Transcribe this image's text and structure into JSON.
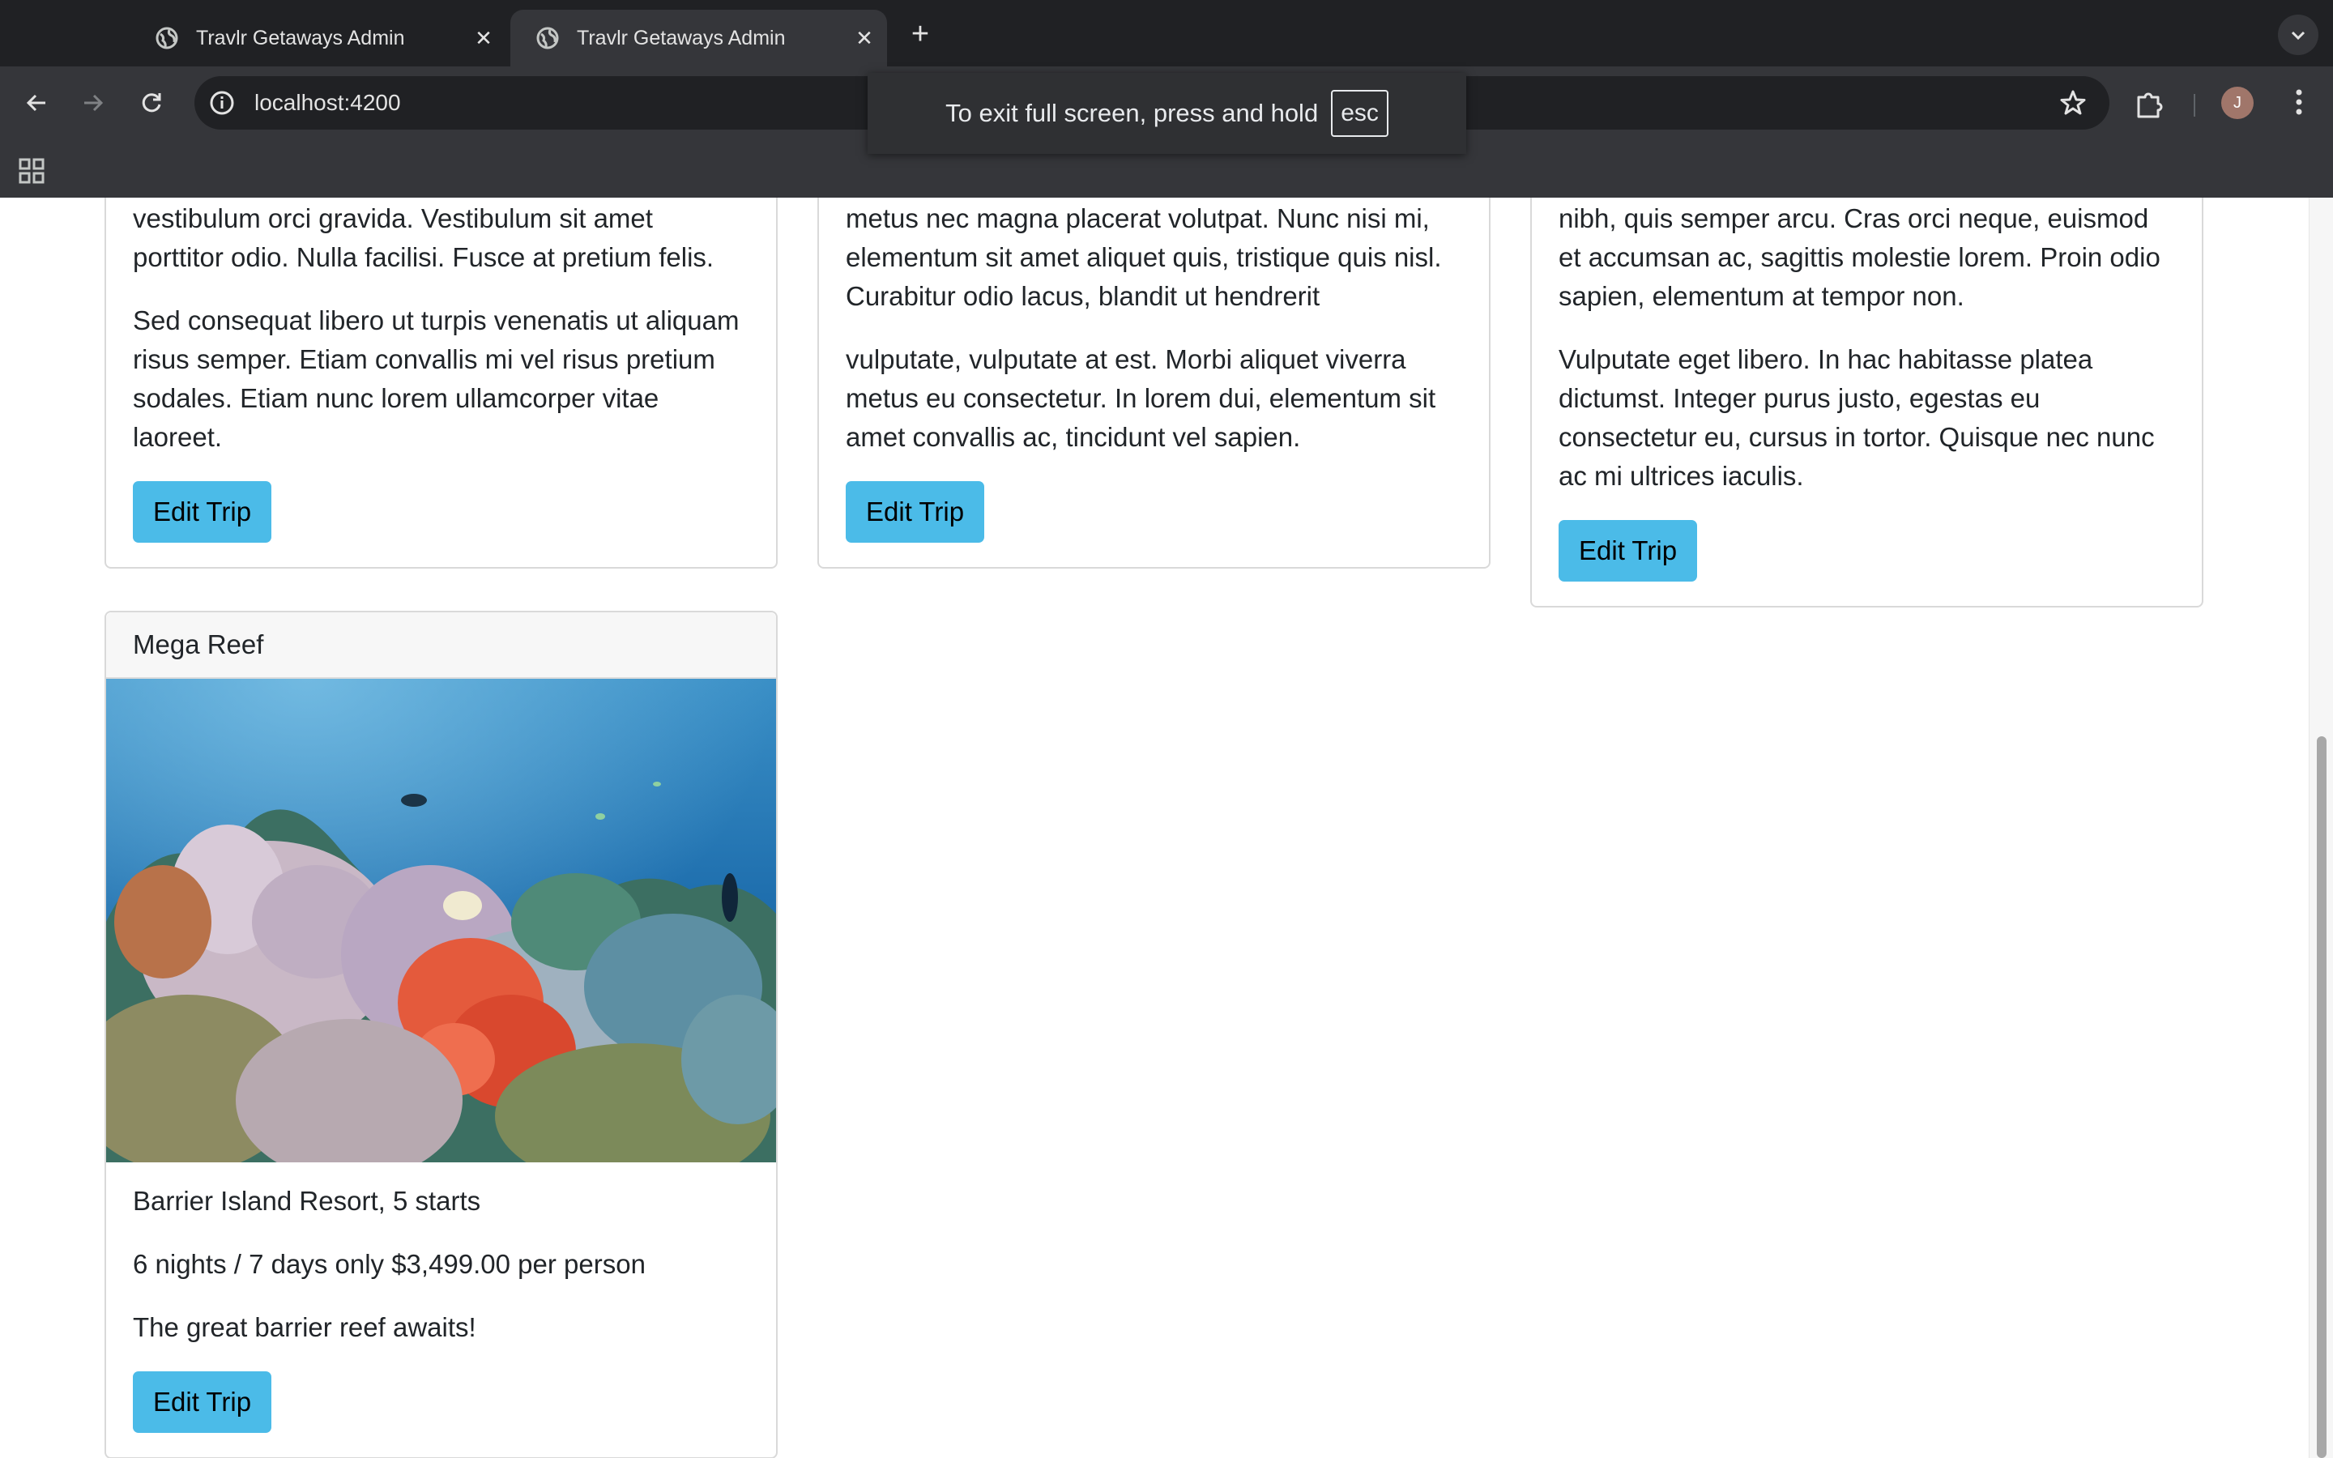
{
  "browser": {
    "tabs": [
      {
        "title": "Travlr Getaways Admin",
        "active": false
      },
      {
        "title": "Travlr Getaways Admin",
        "active": true
      }
    ],
    "url": "localhost:4200",
    "profile_initial": "J",
    "fullscreen_notice": {
      "text": "To exit full screen, press and hold",
      "key": "esc"
    }
  },
  "cards": [
    {
      "paragraphs": [
        "vestibulum orci gravida. Vestibulum sit amet porttitor odio. Nulla facilisi. Fusce at pretium felis.",
        "Sed consequat libero ut turpis venenatis ut aliquam risus semper. Etiam convallis mi vel risus pretium sodales. Etiam nunc lorem ullamcorper vitae laoreet."
      ],
      "button": "Edit Trip"
    },
    {
      "paragraphs": [
        "metus nec magna placerat volutpat. Nunc nisi mi, elementum sit amet aliquet quis, tristique quis nisl. Curabitur odio lacus, blandit ut hendrerit",
        "vulputate, vulputate at est. Morbi aliquet viverra metus eu consectetur. In lorem dui, elementum sit amet convallis ac, tincidunt vel sapien."
      ],
      "button": "Edit Trip"
    },
    {
      "paragraphs": [
        "nibh, quis semper arcu. Cras orci neque, euismod et accumsan ac, sagittis molestie lorem. Proin odio sapien, elementum at tempor non.",
        "Vulputate eget libero. In hac habitasse platea dictumst. Integer purus justo, egestas eu consectetur eu, cursus in tortor. Quisque nec nunc ac mi ultrices iaculis."
      ],
      "button": "Edit Trip"
    }
  ],
  "trip": {
    "name": "Mega Reef",
    "resort": "Barrier Island Resort, 5 starts",
    "price": "6 nights / 7 days only $3,499.00 per person",
    "description": "The great barrier reef awaits!",
    "button": "Edit Trip"
  },
  "colors": {
    "button": "#4bbbe8",
    "chrome_dark": "#202124",
    "chrome_toolbar": "#35363a"
  }
}
